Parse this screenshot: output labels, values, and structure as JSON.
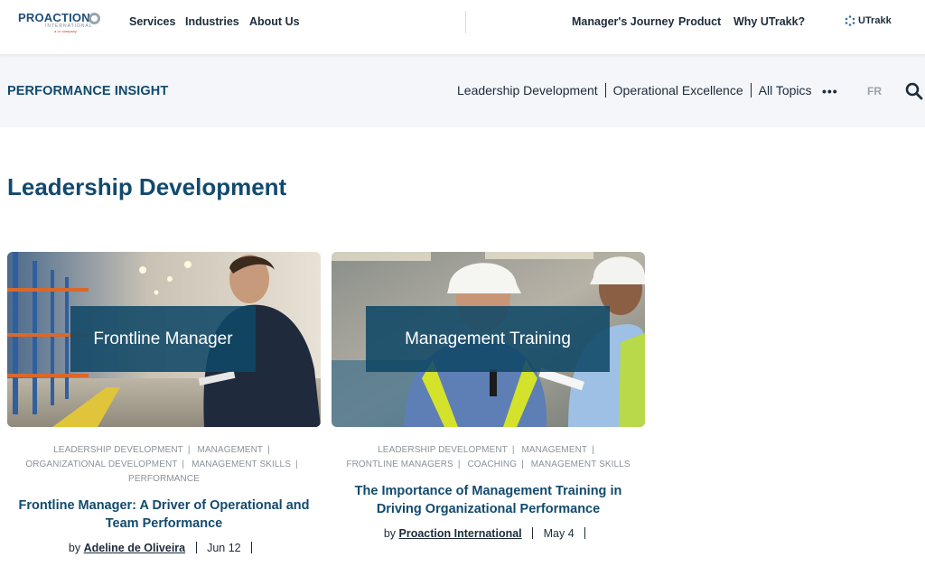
{
  "header": {
    "logo": {
      "name": "PROACTION",
      "subtitle": "INTERNATIONAL",
      "tagline": "a ••• company"
    },
    "nav_left": [
      "Services",
      "Industries",
      "About Us"
    ],
    "nav_right": [
      "Manager's Journey",
      "Product",
      "Why UTrakk?"
    ],
    "utrakk_label": "UTrakk"
  },
  "subnav": {
    "brand": "PERFORMANCE INSIGHT",
    "topics": [
      "Leadership Development",
      "Operational Excellence",
      "All Topics"
    ],
    "more": "•••",
    "lang": "FR",
    "search_icon": "search-icon"
  },
  "page": {
    "title": "Leadership Development"
  },
  "cards": [
    {
      "overlay": "Frontline Manager",
      "tags_line1": [
        "LEADERSHIP DEVELOPMENT",
        "MANAGEMENT",
        ""
      ],
      "tags_line2": [
        "ORGANIZATIONAL DEVELOPMENT",
        "MANAGEMENT SKILLS",
        ""
      ],
      "tags_line3": [
        "PERFORMANCE"
      ],
      "title": "Frontline Manager: A Driver of Operational and Team Performance",
      "by": "by",
      "author": "Adeline de Oliveira",
      "date": "Jun 12"
    },
    {
      "overlay": "Management Training",
      "tags_line1": [
        "LEADERSHIP DEVELOPMENT",
        "MANAGEMENT",
        ""
      ],
      "tags_line2": [
        "FRONTLINE MANAGERS",
        "COACHING",
        "MANAGEMENT SKILLS"
      ],
      "title": "The Importance of Management Training in Driving Organizational Performance",
      "by": "by",
      "author": "Proaction International",
      "date": "May 4"
    }
  ],
  "colors": {
    "brand": "#124a6e",
    "overlay": "#104866",
    "subbar": "#f4f6f9"
  }
}
